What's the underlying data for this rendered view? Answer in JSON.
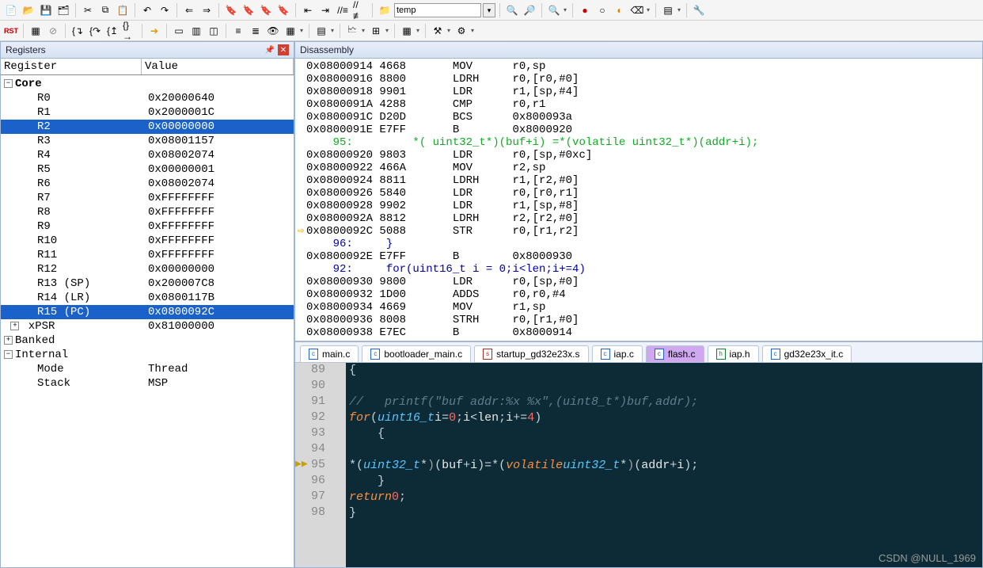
{
  "toolbar1": {
    "edit_field": "temp"
  },
  "panes": {
    "registers_title": "Registers",
    "disasm_title": "Disassembly"
  },
  "registers": {
    "col_name": "Register",
    "col_value": "Value",
    "groups": {
      "core_label": "Core",
      "banked_label": "Banked",
      "internal_label": "Internal",
      "mode_label": "Mode",
      "mode_value": "Thread",
      "stack_label": "Stack",
      "stack_value": "MSP",
      "xpsr_label": "xPSR",
      "xpsr_value": "0x81000000"
    },
    "core": [
      {
        "name": "R0",
        "value": "0x20000640"
      },
      {
        "name": "R1",
        "value": "0x2000001C"
      },
      {
        "name": "R2",
        "value": "0x00000000",
        "sel": true
      },
      {
        "name": "R3",
        "value": "0x08001157"
      },
      {
        "name": "R4",
        "value": "0x08002074"
      },
      {
        "name": "R5",
        "value": "0x00000001"
      },
      {
        "name": "R6",
        "value": "0x08002074"
      },
      {
        "name": "R7",
        "value": "0xFFFFFFFF"
      },
      {
        "name": "R8",
        "value": "0xFFFFFFFF"
      },
      {
        "name": "R9",
        "value": "0xFFFFFFFF"
      },
      {
        "name": "R10",
        "value": "0xFFFFFFFF"
      },
      {
        "name": "R11",
        "value": "0xFFFFFFFF"
      },
      {
        "name": "R12",
        "value": "0x00000000"
      },
      {
        "name": "R13 (SP)",
        "value": "0x200007C8"
      },
      {
        "name": "R14 (LR)",
        "value": "0x0800117B"
      },
      {
        "name": "R15 (PC)",
        "value": "0x0800092C",
        "sel": true
      }
    ]
  },
  "disasm": [
    {
      "g": " ",
      "t": "0x08000914 4668       MOV      r0,sp"
    },
    {
      "g": " ",
      "t": "0x08000916 8800       LDRH     r0,[r0,#0]"
    },
    {
      "g": " ",
      "t": "0x08000918 9901       LDR      r1,[sp,#4]"
    },
    {
      "g": " ",
      "t": "0x0800091A 4288       CMP      r0,r1"
    },
    {
      "g": " ",
      "t": "0x0800091C D20D       BCS      0x800093a"
    },
    {
      "g": " ",
      "t": "0x0800091E E7FF       B        0x8000920"
    },
    {
      "g": " ",
      "t": "    95:         *( uint32_t*)(buf+i) =*(volatile uint32_t*)(addr+i);",
      "cls": "dcomment"
    },
    {
      "g": " ",
      "t": "0x08000920 9803       LDR      r0,[sp,#0xc]"
    },
    {
      "g": " ",
      "t": "0x08000922 466A       MOV      r2,sp"
    },
    {
      "g": " ",
      "t": "0x08000924 8811       LDRH     r1,[r2,#0]"
    },
    {
      "g": " ",
      "t": "0x08000926 5840       LDR      r0,[r0,r1]"
    },
    {
      "g": " ",
      "t": "0x08000928 9902       LDR      r1,[sp,#8]"
    },
    {
      "g": " ",
      "t": "0x0800092A 8812       LDRH     r2,[r2,#0]"
    },
    {
      "g": "⇨",
      "t": "0x0800092C 5088       STR      r0,[r1,r2]",
      "cur": true
    },
    {
      "g": " ",
      "t": "    96:     }",
      "cls": "dsrc"
    },
    {
      "g": " ",
      "t": "0x0800092E E7FF       B        0x8000930"
    },
    {
      "g": " ",
      "t": "    92:     for(uint16_t i = 0;i<len;i+=4)",
      "cls": "dsrc"
    },
    {
      "g": " ",
      "t": "0x08000930 9800       LDR      r0,[sp,#0]"
    },
    {
      "g": " ",
      "t": "0x08000932 1D00       ADDS     r0,r0,#4"
    },
    {
      "g": " ",
      "t": "0x08000934 4669       MOV      r1,sp"
    },
    {
      "g": " ",
      "t": "0x08000936 8008       STRH     r0,[r1,#0]"
    },
    {
      "g": " ",
      "t": "0x08000938 E7EC       B        0x8000914"
    }
  ],
  "editor": {
    "tabs": [
      {
        "label": "main.c",
        "kind": "c"
      },
      {
        "label": "bootloader_main.c",
        "kind": "c"
      },
      {
        "label": "startup_gd32e23x.s",
        "kind": "s"
      },
      {
        "label": "iap.c",
        "kind": "c"
      },
      {
        "label": "flash.c",
        "kind": "c",
        "active": true
      },
      {
        "label": "iap.h",
        "kind": "h"
      },
      {
        "label": "gd32e23x_it.c",
        "kind": "c"
      }
    ],
    "first_line": 89,
    "lines": [
      {
        "n": 89,
        "raw": "{"
      },
      {
        "n": 90,
        "raw": ""
      },
      {
        "n": 91,
        "raw": "//   printf(\"buf addr:%x %x\",(uint8_t*)buf,addr);",
        "cls": "comment"
      },
      {
        "n": 92,
        "raw": "    for(uint16_t i = 0;i<len;i+=4)",
        "kind": "for"
      },
      {
        "n": 93,
        "raw": "    {"
      },
      {
        "n": 94,
        "raw": ""
      },
      {
        "n": 95,
        "raw": "        *( uint32_t*)(buf+i) =*(volatile uint32_t*)(addr+i);",
        "kind": "assign",
        "cur": true
      },
      {
        "n": 96,
        "raw": "    }"
      },
      {
        "n": 97,
        "raw": "    return 0;",
        "kind": "return"
      },
      {
        "n": 98,
        "raw": "}"
      }
    ]
  },
  "watermark": "CSDN @NULL_1969"
}
